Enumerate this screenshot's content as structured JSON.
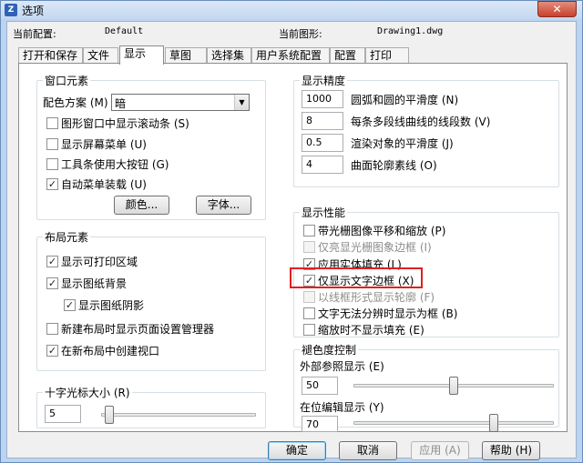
{
  "window": {
    "title": "选项",
    "close_label": "✕"
  },
  "header": {
    "current_config_label": "当前配置:",
    "current_config_value": "Default",
    "current_drawing_label": "当前图形:",
    "current_drawing_value": "Drawing1.dwg"
  },
  "tabs": [
    "打开和保存",
    "文件",
    "显示",
    "草图",
    "选择集",
    "用户系统配置",
    "配置",
    "打印"
  ],
  "window_elements": {
    "title": "窗口元素",
    "color_scheme_label": "配色方案 (M)",
    "color_scheme_value": "暗",
    "options": [
      {
        "label": "图形窗口中显示滚动条 (S)",
        "checked": false
      },
      {
        "label": "显示屏幕菜单 (U)",
        "checked": false
      },
      {
        "label": "工具条使用大按钮 (G)",
        "checked": false
      },
      {
        "label": "自动菜单装载 (U)",
        "checked": true
      }
    ],
    "colors_button": "颜色...",
    "fonts_button": "字体..."
  },
  "layout_elements": {
    "title": "布局元素",
    "options": [
      {
        "label": "显示可打印区域",
        "checked": true
      },
      {
        "label": "显示图纸背景",
        "checked": true
      },
      {
        "label": "显示图纸阴影",
        "checked": true
      },
      {
        "label": "新建布局时显示页面设置管理器",
        "checked": false
      },
      {
        "label": "在新布局中创建视口",
        "checked": true
      }
    ]
  },
  "crosshair": {
    "title": "十字光标大小 (R)",
    "value": "5",
    "level": 0.05
  },
  "display_resolution": {
    "title": "显示精度",
    "items": [
      {
        "value": "1000",
        "label": "圆弧和圆的平滑度 (N)"
      },
      {
        "value": "8",
        "label": "每条多段线曲线的线段数 (V)"
      },
      {
        "value": "0.5",
        "label": "渲染对象的平滑度 (J)"
      },
      {
        "value": "4",
        "label": "曲面轮廓素线 (O)"
      }
    ]
  },
  "display_performance": {
    "title": "显示性能",
    "options": [
      {
        "label": "带光栅图像平移和缩放 (P)",
        "checked": false,
        "disabled": false
      },
      {
        "label": "仅亮显光栅图象边框 (I)",
        "checked": false,
        "disabled": true
      },
      {
        "label": "应用实体填充 (L)",
        "checked": true,
        "disabled": false
      },
      {
        "label": "仅显示文字边框 (X)",
        "checked": true,
        "disabled": false
      },
      {
        "label": "以线框形式显示轮廓 (F)",
        "checked": false,
        "disabled": true
      },
      {
        "label": "文字无法分辨时显示为框 (B)",
        "checked": false,
        "disabled": false
      },
      {
        "label": "缩放时不显示填充 (E)",
        "checked": false,
        "disabled": false
      }
    ]
  },
  "fade_control": {
    "title": "褪色度控制",
    "xref_label": "外部参照显示 (E)",
    "xref_value": "50",
    "xref_level": 0.5,
    "inplace_label": "在位编辑显示 (Y)",
    "inplace_value": "70",
    "inplace_level": 0.7
  },
  "footer": {
    "ok": "确定",
    "cancel": "取消",
    "apply": "应用 (A)",
    "help": "帮助 (H)"
  },
  "colors": {
    "highlight": "#e02020",
    "title_bar": "#c4d8f0"
  }
}
